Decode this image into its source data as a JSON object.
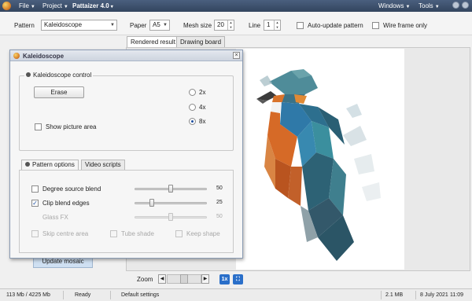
{
  "menubar": {
    "file": "File",
    "project": "Project",
    "app_title": "Pattaizer 4.0",
    "windows": "Windows",
    "tools": "Tools"
  },
  "toolbar": {
    "pattern_label": "Pattern",
    "pattern_value": "Kaleidoscope",
    "paper_label": "Paper",
    "paper_value": "A5",
    "mesh_label": "Mesh size",
    "mesh_value": "20",
    "line_label": "Line",
    "line_value": "1",
    "auto_update_label": "Auto-update pattern",
    "auto_update_checked": false,
    "wire_frame_label": "Wire frame only",
    "wire_frame_checked": false
  },
  "view_tabs": [
    "Rendered result",
    "Drawing board"
  ],
  "left_panel": {
    "update_mosaic_label": "Update mosaic"
  },
  "zoom": {
    "label": "Zoom",
    "fit_label": "1x"
  },
  "status": {
    "memory": "113 Mb / 4225 Mb",
    "state": "Ready",
    "settings": "Default settings",
    "file_size": "2.1 MB",
    "date": "8 July 2021",
    "time": "11:09"
  },
  "dialog": {
    "title": "Kaleidoscope",
    "control_group": "Kaleidoscope control",
    "erase_label": "Erase",
    "show_picture_label": "Show picture area",
    "show_picture_checked": false,
    "radio_options": [
      "2x",
      "4x",
      "8x"
    ],
    "radio_selected": "8x",
    "tabs": [
      "Pattern options",
      "Video scripts"
    ],
    "options": {
      "degree_source_blend": {
        "label": "Degree source blend",
        "value": "50",
        "checked": false
      },
      "clip_blend_edges": {
        "label": "Clip blend edges",
        "value": "25",
        "checked": true
      },
      "glass_fx": {
        "label": "Glass FX",
        "value": "50",
        "checked": false
      },
      "skip_centre_area": "Skip centre area",
      "tube_shade": "Tube shade",
      "keep_shape": "Keep shape"
    }
  },
  "colors": {
    "menubar": "#3e5170",
    "accent": "#2a6fc9",
    "bird_blue": "#2f79a8",
    "bird_orange": "#d9732a"
  }
}
